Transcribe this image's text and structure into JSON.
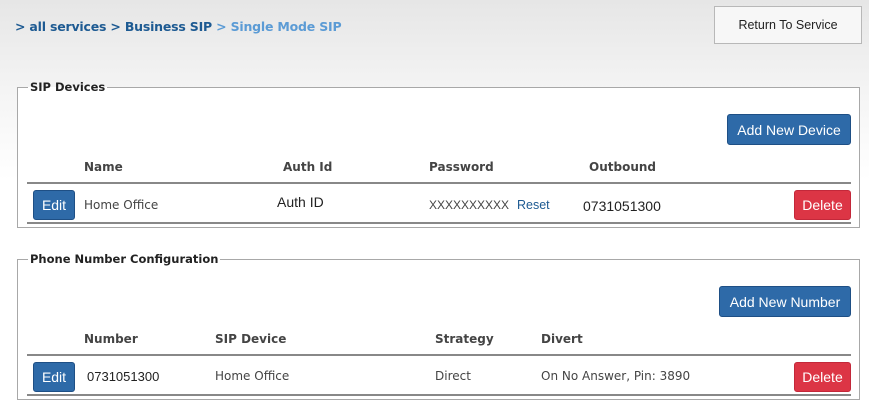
{
  "breadcrumb": {
    "items": [
      "> all services",
      "> Business SIP",
      "> Single Mode SIP"
    ]
  },
  "header": {
    "return_label": "Return To Service"
  },
  "sip_devices": {
    "legend": "SIP Devices",
    "add_label": "Add New Device",
    "columns": [
      "Name",
      "Auth Id",
      "Password",
      "Outbound"
    ],
    "rows": [
      {
        "edit_label": "Edit",
        "name": "Home Office",
        "auth_id": "Auth ID",
        "password": "XXXXXXXXXX",
        "reset_label": "Reset",
        "outbound": "0731051300",
        "delete_label": "Delete"
      }
    ]
  },
  "phone_numbers": {
    "legend": "Phone Number Configuration",
    "add_label": "Add New Number",
    "columns": [
      "Number",
      "SIP Device",
      "Strategy",
      "Divert"
    ],
    "rows": [
      {
        "edit_label": "Edit",
        "number": "0731051300",
        "sip_device": "Home Office",
        "strategy": "Direct",
        "divert": "On No Answer, Pin: 3890",
        "delete_label": "Delete"
      }
    ]
  },
  "colors": {
    "primary_button": "#2e6aa8",
    "danger_button": "#dc3545",
    "link": "#1d5a92",
    "current_crumb": "#5b9bd5"
  }
}
